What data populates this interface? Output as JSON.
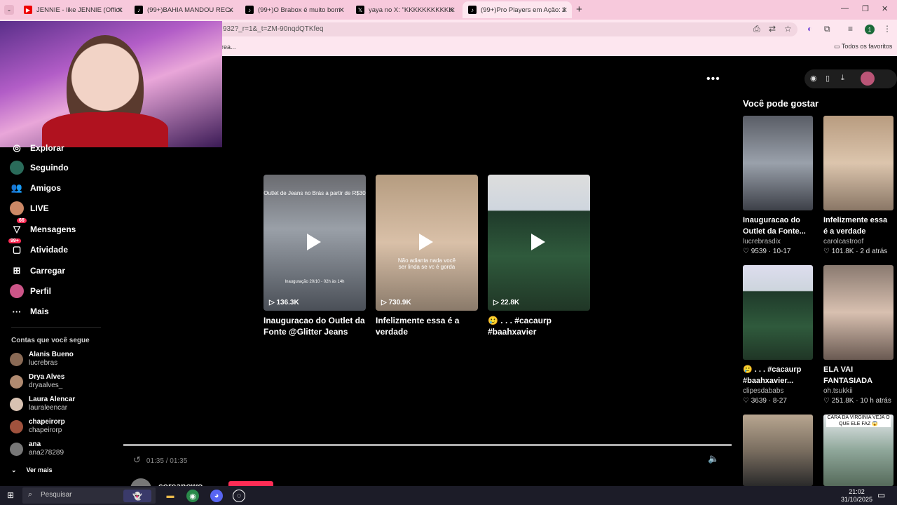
{
  "browser": {
    "tabs": [
      {
        "title": "JENNIE - like JENNIE (Official V",
        "icon": "youtube-icon"
      },
      {
        "title": "(99+)BAHIA MANDOU RECADO",
        "icon": "tiktok-icon"
      },
      {
        "title": "(99+)O Brabox é muito bom k",
        "icon": "tiktok-icon"
      },
      {
        "title": "yaya no X: \"KKKKKKKKKKKKKK",
        "icon": "x-icon"
      },
      {
        "title": "(99+)Pro Players em Ação: Jog",
        "icon": "tiktok-icon"
      }
    ],
    "url": "932?_r=1&_t=ZM-90nqdQTKfeq",
    "bookmark_left": "rea...",
    "bookmarks_all": "Todos os favoritos",
    "profile_initial": "1"
  },
  "sidebar": {
    "items": [
      {
        "label": "Explorar",
        "icon": "compass-icon"
      },
      {
        "label": "Seguindo",
        "icon": "following-icon"
      },
      {
        "label": "Amigos",
        "icon": "friends-icon"
      },
      {
        "label": "LIVE",
        "icon": "live-icon"
      },
      {
        "label": "Mensagens",
        "icon": "messages-icon",
        "badge": "66"
      },
      {
        "label": "Atividade",
        "icon": "activity-icon",
        "badge": "99+"
      },
      {
        "label": "Carregar",
        "icon": "upload-icon"
      },
      {
        "label": "Perfil",
        "icon": "profile-icon"
      },
      {
        "label": "Mais",
        "icon": "more-icon"
      }
    ],
    "following_title": "Contas que você segue",
    "following": [
      {
        "name": "Alanis Bueno",
        "user": "lucrebras"
      },
      {
        "name": "Drya Alves",
        "user": "dryaalves_"
      },
      {
        "name": "Laura Alencar",
        "user": "lauraleencar"
      },
      {
        "name": "chapeirorp",
        "user": "chapeirorp"
      },
      {
        "name": "ana",
        "user": "ana278289"
      }
    ],
    "see_more": "Ver mais"
  },
  "player": {
    "grid": [
      {
        "caption": "Inauguracao do Outlet da Fonte @Glitter Jeans de...",
        "views": "136.3K",
        "overlay_top": "Outlet de Jeans no Brás a partir de R$30",
        "overlay_bottom": "Inauguração 20/10 - 02h às 14h"
      },
      {
        "caption": "Infelizmente essa é a verdade",
        "views": "730.9K",
        "overlay_mid": "Não adianta nada você ser linda se vc é gorda"
      },
      {
        "caption": "🥲 . . . #cacaurp #baahxavier #mavihfpss...",
        "views": "22.8K"
      }
    ],
    "time": "01:35 / 01:35",
    "progress": 1.0,
    "author": "coreanowo"
  },
  "recommend": {
    "title": "Você pode gostar",
    "items": [
      {
        "caption": "Inauguracao do Outlet da Fonte...",
        "author": "lucrebrasdix",
        "likes": "9539",
        "date": "10-17"
      },
      {
        "caption": "Infelizmente essa é a verdade",
        "author": "carolcastroof",
        "likes": "101.8K",
        "date": "2 d atrás"
      },
      {
        "caption": "🥲 . . . #cacaurp #baahxavier...",
        "author": "clipesdababs",
        "likes": "3639",
        "date": "8-27"
      },
      {
        "caption": "ELA VAI FANTASIADA SIM...",
        "author": "oh.tsukkii",
        "likes": "251.8K",
        "date": "10 h atrás"
      },
      {
        "caption": "",
        "author": "",
        "likes": "",
        "date": "",
        "overlay": ""
      },
      {
        "caption": "",
        "author": "",
        "likes": "",
        "date": "",
        "overlay": "CARA DA VIRGINIA VEJA O QUE ELE FAZ 😱"
      }
    ]
  },
  "taskbar": {
    "search": "Pesquisar",
    "time": "21:02",
    "date": "31/10/2025"
  },
  "colors": {
    "accent": "#fe2c55",
    "chrome_tabbar": "#f7c9dc",
    "chrome_toolbar": "#fde6ef"
  }
}
